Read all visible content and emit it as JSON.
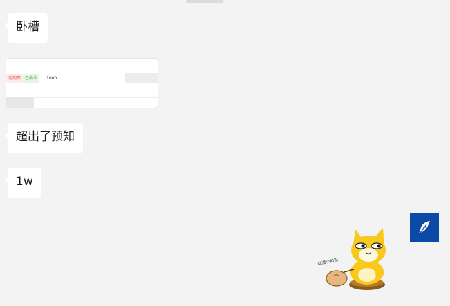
{
  "messages": [
    {
      "id": "b1",
      "text": "卧槽"
    },
    {
      "id": "b3",
      "text": "超出了预知"
    },
    {
      "id": "b4",
      "text": "1w"
    }
  ],
  "image_card": {
    "tag_red": "逾期费",
    "tag_green": "已确认",
    "number": "1000"
  },
  "sticker": {
    "caption": "动漫小知识"
  },
  "float_button": {
    "icon": "feather-icon",
    "color": "#0b4aa6"
  },
  "colors": {
    "background": "#f3f3f3",
    "bubble": "#ffffff"
  }
}
